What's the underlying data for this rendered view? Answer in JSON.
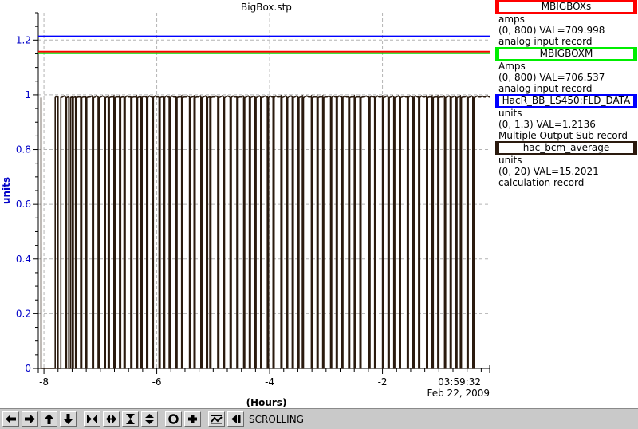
{
  "chart_data": {
    "type": "line",
    "title": "BigBox.stp",
    "xlabel": "(Hours)",
    "ylabel": "units",
    "xlim": [
      -8.1,
      -0.1
    ],
    "ylim": [
      0,
      1.3
    ],
    "x_ticks": [
      -8,
      -6,
      -4,
      -2
    ],
    "x_tick_labels": [
      "-8",
      "-6",
      "-4",
      "-2"
    ],
    "y_ticks": [
      0,
      0.2,
      0.4,
      0.6,
      0.8,
      1,
      1.2
    ],
    "y_tick_labels": [
      "0",
      "0.2",
      "0.4",
      "0.6",
      "0.8",
      "1",
      "1.2"
    ],
    "grid": true,
    "end_time": "03:59:32",
    "end_date": "Feb 22, 2009",
    "series": [
      {
        "name": "MBIGBOXs",
        "color": "#ff0000",
        "style": "flat",
        "y_value": 1.158,
        "scale": [
          0,
          800
        ],
        "current_value": 709.998
      },
      {
        "name": "MBIGBOXM",
        "color": "#00dd00",
        "style": "flat",
        "y_value": 1.152,
        "scale": [
          0,
          800
        ],
        "current_value": 706.537
      },
      {
        "name": "HacR_BB_LS450:FLD_DATA",
        "color": "#0000ff",
        "style": "flat",
        "y_value": 1.2136,
        "scale": [
          0,
          1.3
        ],
        "current_value": 1.2136
      },
      {
        "name": "hac_bcm_average",
        "color": "#2a1a0e",
        "style": "trips",
        "baseline": 0.99,
        "scale": [
          0,
          20
        ],
        "current_value": 15.2021,
        "dropouts": [
          [
            -8.05,
            -7.8
          ],
          [
            -7.75,
            -7.7
          ],
          [
            -7.62,
            -7.6
          ],
          [
            -7.56,
            -7.53
          ],
          [
            -7.5,
            -7.48
          ],
          [
            -7.44,
            -7.42
          ],
          [
            -7.35,
            -7.33
          ],
          [
            -7.26,
            -7.24
          ],
          [
            -7.14,
            -7.12
          ],
          [
            -7.04,
            -7.02
          ],
          [
            -6.93,
            -6.91
          ],
          [
            -6.86,
            -6.84
          ],
          [
            -6.76,
            -6.74
          ],
          [
            -6.66,
            -6.64
          ],
          [
            -6.58,
            -6.56
          ],
          [
            -6.46,
            -6.44
          ],
          [
            -6.36,
            -6.34
          ],
          [
            -6.28,
            -6.26
          ],
          [
            -6.18,
            -6.16
          ],
          [
            -6.08,
            -6.06
          ],
          [
            -5.96,
            -5.94
          ],
          [
            -5.88,
            -5.86
          ],
          [
            -5.78,
            -5.76
          ],
          [
            -5.66,
            -5.64
          ],
          [
            -5.56,
            -5.54
          ],
          [
            -5.42,
            -5.4
          ],
          [
            -5.34,
            -5.32
          ],
          [
            -5.22,
            -5.2
          ],
          [
            -5.12,
            -5.1
          ],
          [
            -5.06,
            -5.04
          ],
          [
            -4.92,
            -4.9
          ],
          [
            -4.82,
            -4.8
          ],
          [
            -4.7,
            -4.68
          ],
          [
            -4.58,
            -4.56
          ],
          [
            -4.46,
            -4.44
          ],
          [
            -4.36,
            -4.34
          ],
          [
            -4.26,
            -4.24
          ],
          [
            -4.16,
            -4.14
          ],
          [
            -4.04,
            -4.02
          ],
          [
            -3.94,
            -3.92
          ],
          [
            -3.8,
            -3.78
          ],
          [
            -3.7,
            -3.68
          ],
          [
            -3.6,
            -3.58
          ],
          [
            -3.5,
            -3.48
          ],
          [
            -3.42,
            -3.4
          ],
          [
            -3.26,
            -3.24
          ],
          [
            -3.16,
            -3.14
          ],
          [
            -3.06,
            -3.04
          ],
          [
            -2.92,
            -2.9
          ],
          [
            -2.82,
            -2.8
          ],
          [
            -2.72,
            -2.7
          ],
          [
            -2.6,
            -2.58
          ],
          [
            -2.5,
            -2.48
          ],
          [
            -2.4,
            -2.38
          ],
          [
            -2.24,
            -2.22
          ],
          [
            -2.14,
            -2.12
          ],
          [
            -2.0,
            -1.98
          ],
          [
            -1.9,
            -1.88
          ],
          [
            -1.8,
            -1.78
          ],
          [
            -1.7,
            -1.68
          ],
          [
            -1.56,
            -1.54
          ],
          [
            -1.46,
            -1.44
          ],
          [
            -1.36,
            -1.34
          ],
          [
            -1.22,
            -1.2
          ],
          [
            -1.12,
            -1.1
          ],
          [
            -1.02,
            -1.0
          ],
          [
            -0.9,
            -0.88
          ],
          [
            -0.8,
            -0.78
          ],
          [
            -0.7,
            -0.68
          ],
          [
            -0.62,
            -0.6
          ],
          [
            -0.5,
            -0.48
          ],
          [
            -0.4,
            -0.38
          ]
        ]
      }
    ]
  },
  "legend": [
    {
      "name": "MBIGBOXs",
      "unit": "amps",
      "range": "(0, 800) VAL=709.998",
      "record": "analog input record",
      "color": "#ff0000"
    },
    {
      "name": "MBIGBOXM",
      "unit": "Amps",
      "range": "(0, 800) VAL=706.537",
      "record": "analog input record",
      "color": "#00ee00"
    },
    {
      "name": "HacR_BB_LS450:FLD_DATA",
      "unit": "units",
      "range": "(0, 1.3) VAL=1.2136",
      "record": "Multiple Output Sub record",
      "color": "#0000ff"
    },
    {
      "name": "hac_bcm_average",
      "unit": "units",
      "range": "(0, 20) VAL=15.2021",
      "record": "calculation record",
      "color": "#2a1a0e"
    }
  ],
  "toolbar": {
    "buttons": [
      {
        "icon": "arrow-left-icon"
      },
      {
        "icon": "arrow-right-icon"
      },
      {
        "icon": "arrow-up-icon"
      },
      {
        "icon": "arrow-down-icon"
      },
      {
        "icon": "zoom-in-horizontal-icon"
      },
      {
        "icon": "zoom-out-horizontal-icon"
      },
      {
        "icon": "zoom-in-vertical-icon"
      },
      {
        "icon": "zoom-out-vertical-icon"
      },
      {
        "icon": "auto-scale-icon"
      },
      {
        "icon": "add-icon"
      },
      {
        "icon": "scroll-mode-icon"
      },
      {
        "icon": "jump-to-end-icon"
      }
    ],
    "status": "SCROLLING"
  }
}
